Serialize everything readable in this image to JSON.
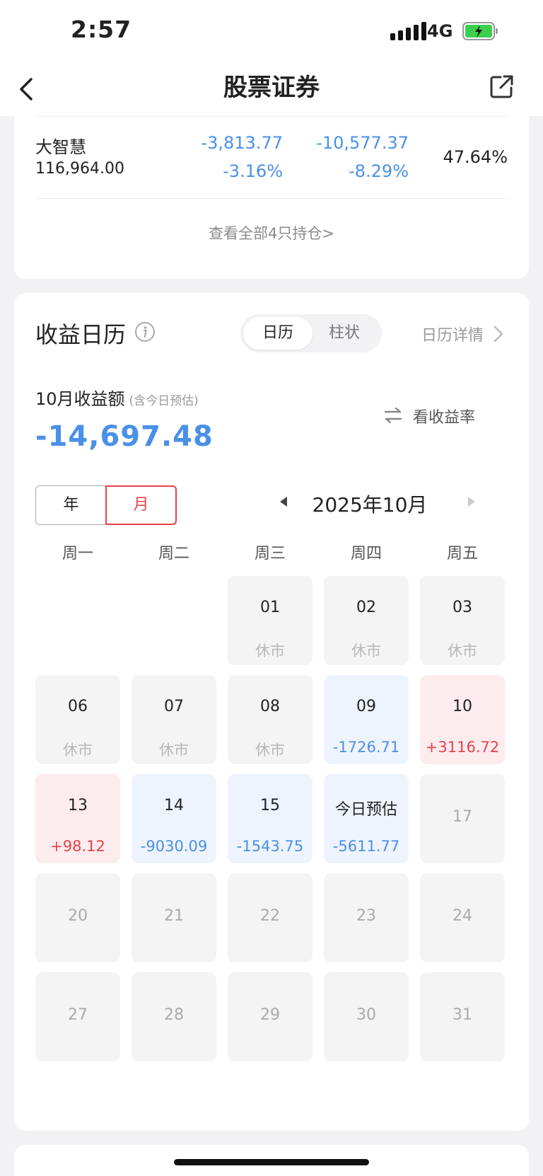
{
  "status_bar": {
    "time": "2:57",
    "network": "4G"
  },
  "nav": {
    "title": "股票证券"
  },
  "holding": {
    "name": "大智慧",
    "value": "116,964.00",
    "day_change": "-3,813.77",
    "day_change_pct": "-3.16%",
    "total_change": "-10,577.37",
    "total_change_pct": "-8.29%",
    "position_ratio": "47.64%",
    "view_all": "查看全部4只持仓>"
  },
  "calendar": {
    "title": "收益日历",
    "view_tabs": [
      "日历",
      "柱状"
    ],
    "detail_link": "日历详情",
    "month_label": "10月收益额",
    "month_label_note": "(含今日预估)",
    "month_amount": "-14,697.48",
    "yield_link": "看收益率",
    "toggle": {
      "year": "年",
      "month": "月"
    },
    "current_month": "2025年10月",
    "weekdays": [
      "周一",
      "周二",
      "周三",
      "周四",
      "周五"
    ],
    "weeks": [
      [
        null,
        null,
        {
          "d": "01",
          "v": "休市",
          "t": "closed"
        },
        {
          "d": "02",
          "v": "休市",
          "t": "closed"
        },
        {
          "d": "03",
          "v": "休市",
          "t": "closed"
        }
      ],
      [
        {
          "d": "06",
          "v": "休市",
          "t": "closed"
        },
        {
          "d": "07",
          "v": "休市",
          "t": "closed"
        },
        {
          "d": "08",
          "v": "休市",
          "t": "closed"
        },
        {
          "d": "09",
          "v": "-1726.71",
          "t": "neg"
        },
        {
          "d": "10",
          "v": "+3116.72",
          "t": "pos"
        }
      ],
      [
        {
          "d": "13",
          "v": "+98.12",
          "t": "pos"
        },
        {
          "d": "14",
          "v": "-9030.09",
          "t": "neg"
        },
        {
          "d": "15",
          "v": "-1543.75",
          "t": "neg"
        },
        {
          "d": "今日预估",
          "v": "-5611.77",
          "t": "neg"
        },
        {
          "d": "17",
          "v": "",
          "t": "future"
        }
      ],
      [
        {
          "d": "20",
          "v": "",
          "t": "future"
        },
        {
          "d": "21",
          "v": "",
          "t": "future"
        },
        {
          "d": "22",
          "v": "",
          "t": "future"
        },
        {
          "d": "23",
          "v": "",
          "t": "future"
        },
        {
          "d": "24",
          "v": "",
          "t": "future"
        }
      ],
      [
        {
          "d": "27",
          "v": "",
          "t": "future"
        },
        {
          "d": "28",
          "v": "",
          "t": "future"
        },
        {
          "d": "29",
          "v": "",
          "t": "future"
        },
        {
          "d": "30",
          "v": "",
          "t": "future"
        },
        {
          "d": "31",
          "v": "",
          "t": "future"
        }
      ]
    ]
  },
  "colors": {
    "loss": "#4a90e8",
    "gain": "#e8424c",
    "accent": "#e8424c"
  },
  "icons": [
    "signal-icon",
    "battery-icon",
    "back-icon",
    "share-icon",
    "info-icon",
    "chevron-right-icon",
    "swap-icon",
    "triangle-left-icon",
    "triangle-right-icon"
  ]
}
